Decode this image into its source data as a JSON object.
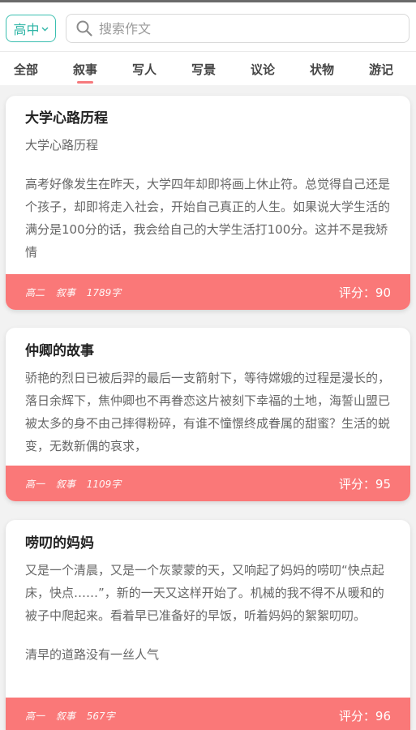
{
  "search": {
    "grade": "高中",
    "placeholder": "搜索作文"
  },
  "tabs": [
    {
      "label": "全部"
    },
    {
      "label": "叙事"
    },
    {
      "label": "写人"
    },
    {
      "label": "写景"
    },
    {
      "label": "议论"
    },
    {
      "label": "状物"
    },
    {
      "label": "游记"
    }
  ],
  "active_tab": "叙事",
  "essays": [
    {
      "title": "大学心路历程",
      "subtitle": "大学心路历程",
      "excerpt": "高考好像发生在昨天，大学四年却即将画上休止符。总觉得自己还是个孩子，却即将走入社会，开始自己真正的人生。如果说大学生活的满分是100分的话，我会给自己的大学生活打100分。这并不是我矫情",
      "grade": "高二",
      "category": "叙事",
      "words": "1789字",
      "score": "评分：90"
    },
    {
      "title": "仲卿的故事",
      "excerpt": "骄艳的烈日已被后羿的最后一支箭射下，等待嫦娥的过程是漫长的，落日余辉下，焦仲卿也不再眷恋这片被刻下幸福的土地，海誓山盟已被太多的身不由己摔得粉碎，有谁不憧憬终成眷属的甜蜜？生活的蜕变，无数新偶的哀求，",
      "grade": "高一",
      "category": "叙事",
      "words": "1109字",
      "score": "评分：95"
    },
    {
      "title": "唠叨的妈妈",
      "excerpt": "又是一个清晨，又是一个灰蒙蒙的天，又响起了妈妈的唠叨“快点起床，快点……”，新的一天又这样开始了。机械的我不得不从暖和的被子中爬起来。看着早已准备好的早饭，听着妈妈的絮絮叨叨。",
      "excerpt2": "清早的道路没有一丝人气",
      "grade": "高一",
      "category": "叙事",
      "words": "567字",
      "score": "评分：96"
    }
  ]
}
